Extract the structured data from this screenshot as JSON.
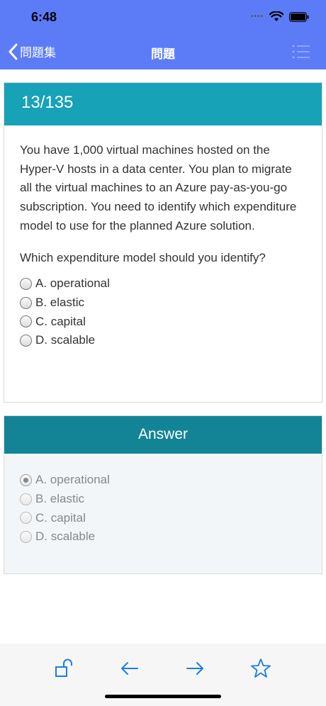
{
  "status_bar": {
    "time": "6:48",
    "signal_dots": "••••"
  },
  "nav": {
    "back_label": "問題集",
    "title": "問題"
  },
  "question": {
    "counter": "13/135",
    "text": "You have 1,000 virtual machines hosted on the Hyper-V hosts in a data center. You plan to migrate all the virtual machines to an Azure pay-as-you-go subscription. You need to identify which expenditure model to use for the planned Azure solution.",
    "prompt": "Which expenditure model should you identify?",
    "options": [
      "A. operational",
      "B. elastic",
      "C. capital",
      "D. scalable"
    ]
  },
  "answer": {
    "title": "Answer",
    "options": [
      "A. operational",
      "B. elastic",
      "C. capital",
      "D. scalable"
    ],
    "selected_option": "A. operational"
  },
  "toolbar": {
    "buttons": [
      "unlock-icon",
      "arrow-left-icon",
      "arrow-right-icon",
      "star-icon"
    ],
    "accent_color": "#1a7fe0"
  },
  "colors": {
    "nav_bar": "#5c7cf7",
    "question_header": "#17a2b8",
    "answer_header": "#138496"
  }
}
